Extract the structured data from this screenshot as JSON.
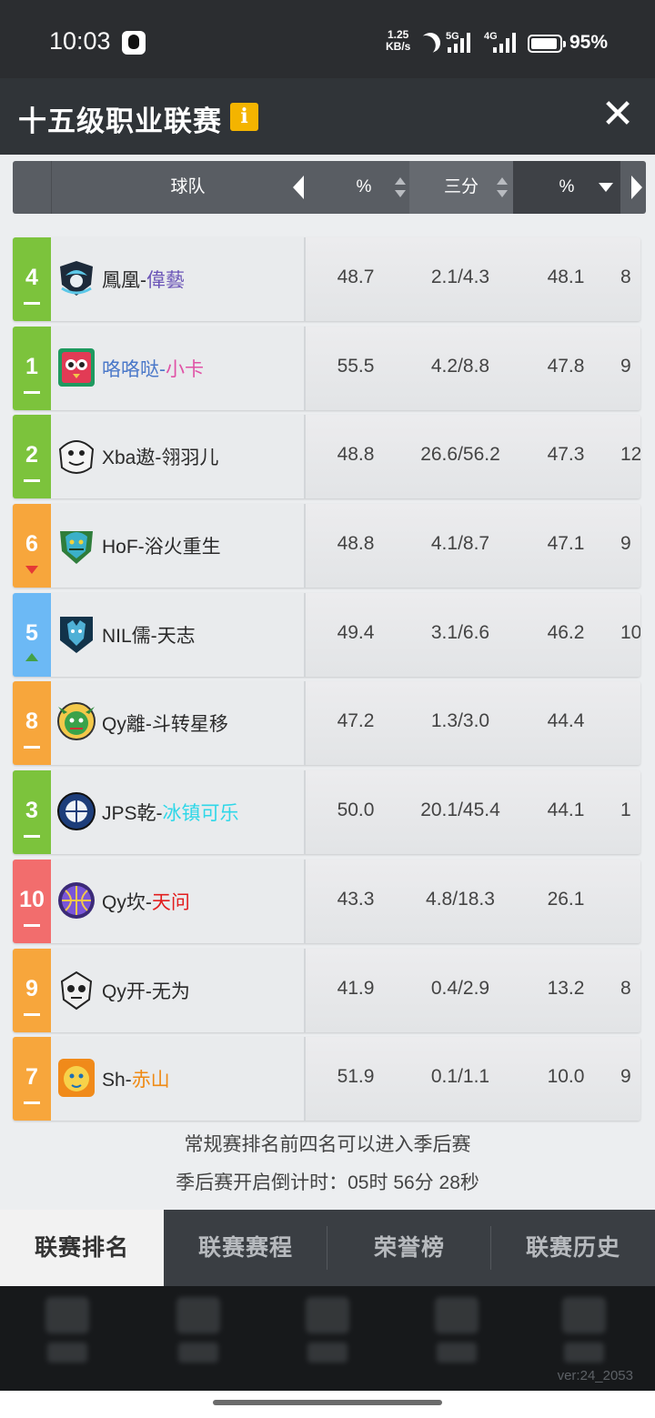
{
  "status": {
    "time": "10:03",
    "net_speed_top": "1.25",
    "net_speed_bottom": "KB/s",
    "sig1": "5G",
    "sig2": "4G",
    "battery": "95%"
  },
  "title": "十五级职业联赛",
  "info_label": "i",
  "close_label": "✕",
  "header": {
    "team": "球队",
    "pct": "%",
    "three": "三分",
    "pct2": "%"
  },
  "colors": {
    "green": "#7cc33c",
    "orange": "#f7a63c",
    "blue": "#6cb9f5",
    "red": "#f26d6d",
    "name_blue": "#4a78c9",
    "name_purple": "#6b55b7",
    "name_pink": "#e052a6",
    "name_cyan": "#2fd7e8",
    "name_red": "#e21d1d",
    "name_orange": "#ef8a14"
  },
  "rows": [
    {
      "rank": "4",
      "trend": "flat",
      "color": "green",
      "prefix": "鳳凰-",
      "suffix": "偉藝",
      "suffix_color": "name_purple",
      "prefix_color": "",
      "logo": "phoenix-logo",
      "v1": "48.7",
      "v2": "2.1/4.3",
      "v3": "48.1",
      "v4": "8"
    },
    {
      "rank": "1",
      "trend": "flat",
      "color": "green",
      "prefix": "咯咯哒-",
      "suffix": "小卡",
      "suffix_color": "name_pink",
      "prefix_color": "name_blue",
      "logo": "owl-logo",
      "v1": "55.5",
      "v2": "4.2/8.8",
      "v3": "47.8",
      "v4": "9"
    },
    {
      "rank": "2",
      "trend": "flat",
      "color": "green",
      "prefix": "Xba遨-",
      "suffix": "翎羽儿",
      "suffix_color": "",
      "prefix_color": "",
      "logo": "yeti-logo",
      "v1": "48.8",
      "v2": "26.6/56.2",
      "v3": "47.3",
      "v4": "12"
    },
    {
      "rank": "6",
      "trend": "down",
      "color": "orange",
      "prefix": "HoF-",
      "suffix": "浴火重生",
      "suffix_color": "",
      "prefix_color": "",
      "logo": "dragon-logo",
      "v1": "48.8",
      "v2": "4.1/8.7",
      "v3": "47.1",
      "v4": "9"
    },
    {
      "rank": "5",
      "trend": "up",
      "color": "blue",
      "prefix": "NIL儒-",
      "suffix": "天志",
      "suffix_color": "",
      "prefix_color": "",
      "logo": "wolf-logo",
      "v1": "49.4",
      "v2": "3.1/6.6",
      "v3": "46.2",
      "v4": "10"
    },
    {
      "rank": "8",
      "trend": "flat",
      "color": "orange",
      "prefix": "Qy離-",
      "suffix": "斗转星移",
      "suffix_color": "",
      "prefix_color": "",
      "logo": "goblin-logo",
      "v1": "47.2",
      "v2": "1.3/3.0",
      "v3": "44.4",
      "v4": ""
    },
    {
      "rank": "3",
      "trend": "flat",
      "color": "green",
      "prefix": "JPS乾-",
      "suffix": "冰镇可乐",
      "suffix_color": "name_cyan",
      "prefix_color": "",
      "logo": "basketball-logo",
      "v1": "50.0",
      "v2": "20.1/45.4",
      "v3": "44.1",
      "v4": "1"
    },
    {
      "rank": "10",
      "trend": "flat",
      "color": "red",
      "prefix": "Qy坎-",
      "suffix": "天问",
      "suffix_color": "name_red",
      "prefix_color": "",
      "logo": "purple-ball-logo",
      "v1": "43.3",
      "v2": "4.8/18.3",
      "v3": "26.1",
      "v4": ""
    },
    {
      "rank": "9",
      "trend": "flat",
      "color": "orange",
      "prefix": "Qy开-",
      "suffix": "无为",
      "suffix_color": "",
      "prefix_color": "",
      "logo": "skull-logo",
      "v1": "41.9",
      "v2": "0.4/2.9",
      "v3": "13.2",
      "v4": "8"
    },
    {
      "rank": "7",
      "trend": "flat",
      "color": "orange",
      "prefix": "Sh-",
      "suffix": "赤山",
      "suffix_color": "name_orange",
      "prefix_color": "",
      "logo": "lion-logo",
      "v1": "51.9",
      "v2": "0.1/1.1",
      "v3": "10.0",
      "v4": "9"
    }
  ],
  "notes": {
    "line1": "常规赛排名前四名可以进入季后赛",
    "line2": "季后赛开启倒计时：05时 56分 28秒"
  },
  "tabs": [
    "联赛排名",
    "联赛赛程",
    "荣誉榜",
    "联赛历史"
  ],
  "version": "ver:24_2053"
}
